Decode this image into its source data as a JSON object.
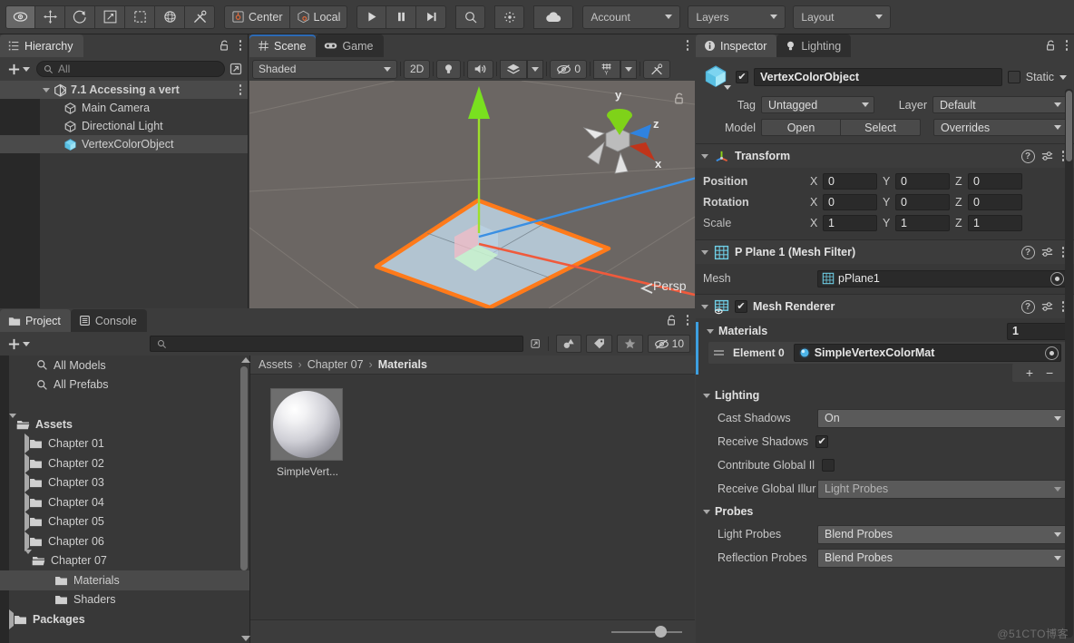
{
  "toolbar": {
    "tools": [
      {
        "name": "hand-tool",
        "icon": "eye",
        "active": true
      },
      {
        "name": "move-tool",
        "icon": "move",
        "active": false
      },
      {
        "name": "rotate-tool",
        "icon": "rotate",
        "active": false
      },
      {
        "name": "scale-tool",
        "icon": "scale",
        "active": false
      },
      {
        "name": "rect-tool",
        "icon": "rect",
        "active": false
      },
      {
        "name": "transform-tool",
        "icon": "transform",
        "active": false
      },
      {
        "name": "custom-tool",
        "icon": "wrench",
        "active": false
      }
    ],
    "pivot_label": "Center",
    "handle_label": "Local",
    "play_label": "play",
    "pause_label": "pause",
    "step_label": "step",
    "search_label": "search",
    "collab_label": "cloud",
    "account_label": "Account",
    "layers_label": "Layers",
    "layout_label": "Layout"
  },
  "hierarchy": {
    "tab_label": "Hierarchy",
    "search_placeholder": "All",
    "items": [
      {
        "label": "7.1 Accessing a vert",
        "icon": "unity-scene-icon",
        "depth": 0,
        "selected": true,
        "expanded": true
      },
      {
        "label": "Main Camera",
        "icon": "gameobject-icon",
        "depth": 1,
        "selected": false
      },
      {
        "label": "Directional Light",
        "icon": "gameobject-icon",
        "depth": 1,
        "selected": false
      },
      {
        "label": "VertexColorObject",
        "icon": "model-icon",
        "depth": 1,
        "selected": true
      }
    ]
  },
  "scene": {
    "tabs": [
      {
        "label": "Scene",
        "icon": "grid-icon",
        "active": true
      },
      {
        "label": "Game",
        "icon": "gamepad-icon",
        "active": false
      }
    ],
    "shading_mode": "Shaded",
    "mode_2d": "2D",
    "hidden_count": "0",
    "gizmo_axes": {
      "x": "x",
      "y": "y",
      "z": "z"
    },
    "projection_label": "Persp"
  },
  "project": {
    "tabs": [
      {
        "label": "Project",
        "icon": "folder-icon",
        "active": true
      },
      {
        "label": "Console",
        "icon": "console-icon",
        "active": false
      }
    ],
    "search_placeholder": "",
    "hidden_count": "10",
    "tree": [
      {
        "label": "All Models",
        "icon": "search-icon",
        "depth": 1,
        "type": "saved-search"
      },
      {
        "label": "All Prefabs",
        "icon": "search-icon",
        "depth": 1,
        "type": "saved-search"
      },
      {
        "label": "",
        "icon": "",
        "depth": 0,
        "type": "spacer"
      },
      {
        "label": "Assets",
        "icon": "folder-open-icon",
        "depth": 0,
        "type": "folder",
        "expanded": true,
        "bold": true
      },
      {
        "label": "Chapter 01",
        "icon": "folder-icon",
        "depth": 1,
        "type": "folder",
        "expanded": false
      },
      {
        "label": "Chapter 02",
        "icon": "folder-icon",
        "depth": 1,
        "type": "folder",
        "expanded": false
      },
      {
        "label": "Chapter 03",
        "icon": "folder-icon",
        "depth": 1,
        "type": "folder",
        "expanded": false
      },
      {
        "label": "Chapter 04",
        "icon": "folder-icon",
        "depth": 1,
        "type": "folder",
        "expanded": false
      },
      {
        "label": "Chapter 05",
        "icon": "folder-icon",
        "depth": 1,
        "type": "folder",
        "expanded": false
      },
      {
        "label": "Chapter 06",
        "icon": "folder-icon",
        "depth": 1,
        "type": "folder",
        "expanded": false
      },
      {
        "label": "Chapter 07",
        "icon": "folder-open-icon",
        "depth": 1,
        "type": "folder",
        "expanded": true
      },
      {
        "label": "Materials",
        "icon": "folder-icon",
        "depth": 2,
        "type": "folder",
        "selected": true
      },
      {
        "label": "Shaders",
        "icon": "folder-icon",
        "depth": 2,
        "type": "folder"
      },
      {
        "label": "Packages",
        "icon": "folder-icon",
        "depth": 0,
        "type": "folder",
        "expanded": false,
        "bold": true
      }
    ],
    "breadcrumb": [
      "Assets",
      "Chapter 07",
      "Materials"
    ],
    "assets": [
      {
        "label": "SimpleVert...",
        "icon": "material-sphere-icon"
      }
    ]
  },
  "inspector": {
    "tabs": [
      {
        "label": "Inspector",
        "icon": "info-icon",
        "active": true
      },
      {
        "label": "Lighting",
        "icon": "bulb-icon",
        "active": false
      }
    ],
    "object_name": "VertexColorObject",
    "enabled": true,
    "static_label": "Static",
    "static_checked": false,
    "tag_label": "Tag",
    "tag_value": "Untagged",
    "layer_label": "Layer",
    "layer_value": "Default",
    "model_label": "Model",
    "open_label": "Open",
    "select_label": "Select",
    "overrides_label": "Overrides",
    "transform": {
      "title": "Transform",
      "rows": [
        {
          "label": "Position",
          "x": "0",
          "y": "0",
          "z": "0"
        },
        {
          "label": "Rotation",
          "x": "0",
          "y": "0",
          "z": "0"
        },
        {
          "label": "Scale",
          "x": "1",
          "y": "1",
          "z": "1"
        }
      ],
      "axis_labels": [
        "X",
        "Y",
        "Z"
      ]
    },
    "mesh_filter": {
      "title": "P Plane 1  (Mesh Filter)",
      "mesh_label": "Mesh",
      "mesh_value": "pPlane1"
    },
    "mesh_renderer": {
      "title": "Mesh Renderer",
      "enabled": true,
      "materials_label": "Materials",
      "materials_count": "1",
      "element_label": "Element 0",
      "element_value": "SimpleVertexColorMat",
      "add_label": "+",
      "remove_label": "−",
      "lighting_label": "Lighting",
      "cast_shadows_label": "Cast Shadows",
      "cast_shadows_value": "On",
      "receive_shadows_label": "Receive Shadows",
      "receive_shadows_checked": true,
      "contribute_gi_label": "Contribute Global Il",
      "contribute_gi_checked": false,
      "receive_gi_label": "Receive Global Illur",
      "receive_gi_value": "Light Probes",
      "probes_label": "Probes",
      "light_probes_label": "Light Probes",
      "light_probes_value": "Blend Probes",
      "reflection_probes_label": "Reflection Probes",
      "reflection_probes_value": "Blend Probes"
    }
  },
  "watermark": "@51CTO博客",
  "colors": {
    "accent_blue": "#3d9fe0",
    "selection": "#4a4a4a",
    "panel_bg": "#383838",
    "chrome_bg": "#3c3c3c",
    "scene_bg": "#6b6663",
    "gizmo_x": "#e8503a",
    "gizmo_y": "#7fd219",
    "gizmo_z": "#2f83e0",
    "outline": "#ff7a1a"
  }
}
